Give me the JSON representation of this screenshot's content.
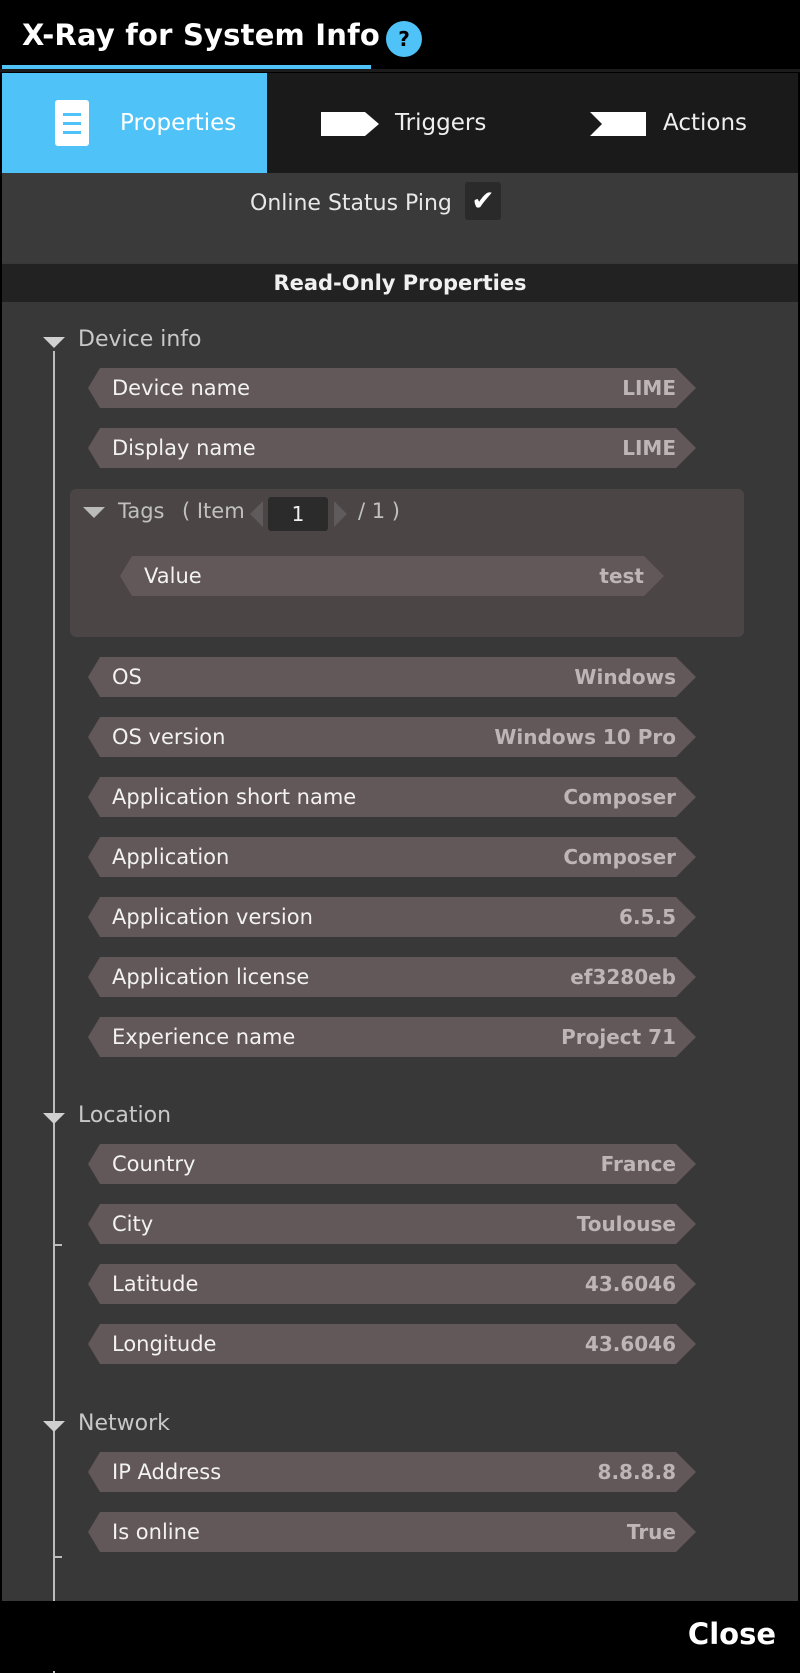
{
  "header": {
    "title": "X-Ray for System Info",
    "help_label": "?"
  },
  "colors": {
    "accent": "#4fc3f7",
    "pill": "#625759",
    "panel": "#383838",
    "tags_box": "#4b4546"
  },
  "tabs": [
    {
      "label": "Properties",
      "icon": "document-icon",
      "active": true
    },
    {
      "label": "Triggers",
      "icon": "trigger-arrow-icon",
      "active": false
    },
    {
      "label": "Actions",
      "icon": "action-arrow-icon",
      "active": false
    }
  ],
  "ping": {
    "label": "Online Status Ping",
    "checked": true,
    "check_glyph": "✔"
  },
  "read_only_title": "Read-Only Properties",
  "groups": {
    "device": {
      "title": "Device info",
      "props": [
        {
          "label": "Device name",
          "value": "LIME"
        },
        {
          "label": "Display name",
          "value": "LIME"
        }
      ],
      "tags": {
        "title": "Tags",
        "item_prefix": "( Item",
        "item_value": "1",
        "item_total": "/ 1 )",
        "value_label": "Value",
        "value": "test"
      },
      "props2": [
        {
          "label": "OS",
          "value": "Windows"
        },
        {
          "label": "OS version",
          "value": "Windows 10 Pro"
        },
        {
          "label": "Application short name",
          "value": "Composer"
        },
        {
          "label": "Application",
          "value": "Composer"
        },
        {
          "label": "Application version",
          "value": "6.5.5"
        },
        {
          "label": "Application license",
          "value": "ef3280eb"
        },
        {
          "label": "Experience name",
          "value": "Project 71"
        }
      ]
    },
    "location": {
      "title": "Location",
      "props": [
        {
          "label": "Country",
          "value": "France"
        },
        {
          "label": "City",
          "value": "Toulouse"
        },
        {
          "label": "Latitude",
          "value": "43.6046"
        },
        {
          "label": "Longitude",
          "value": "43.6046"
        }
      ]
    },
    "network": {
      "title": "Network",
      "props": [
        {
          "label": "IP Address",
          "value": "8.8.8.8"
        },
        {
          "label": "Is online",
          "value": "True"
        }
      ]
    }
  },
  "footer": {
    "close_label": "Close"
  }
}
